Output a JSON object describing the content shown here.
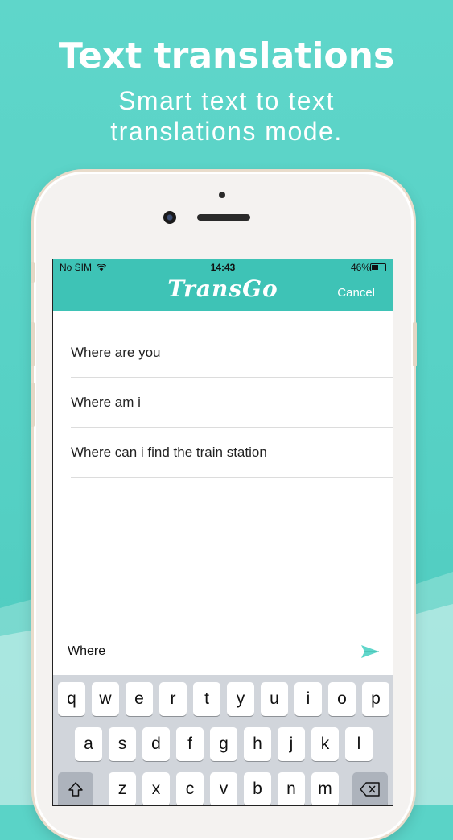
{
  "headline": "Text translations",
  "subheadline_line1": "Smart text to text",
  "subheadline_line2": "translations mode.",
  "status_bar": {
    "carrier": "No SIM",
    "time": "14:43",
    "battery": "46%"
  },
  "app": {
    "brand": "TransGo",
    "cancel_label": "Cancel"
  },
  "history": [
    "Where are you",
    "Where am i",
    "Where can i find the train station"
  ],
  "input_value": "Where",
  "keyboard": {
    "row1": [
      "q",
      "w",
      "e",
      "r",
      "t",
      "y",
      "u",
      "i",
      "o",
      "p"
    ],
    "row2": [
      "a",
      "s",
      "d",
      "f",
      "g",
      "h",
      "j",
      "k",
      "l"
    ],
    "row3": [
      "z",
      "x",
      "c",
      "v",
      "b",
      "n",
      "m"
    ]
  },
  "colors": {
    "background": "#55d0c4",
    "app_bar": "#3ec3b6",
    "send_icon": "#5fd6ca"
  },
  "icons": [
    "wifi-icon",
    "battery-icon",
    "send-icon",
    "shift-icon",
    "backspace-icon"
  ]
}
